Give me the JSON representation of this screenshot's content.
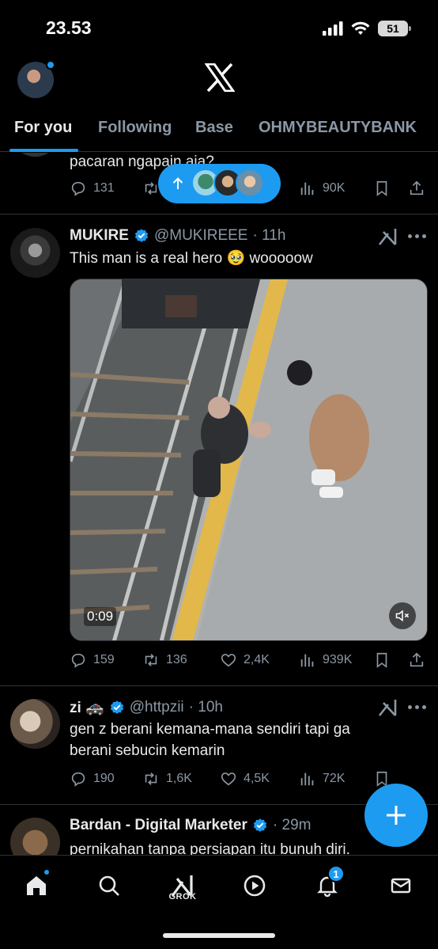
{
  "status_bar": {
    "time": "23.53",
    "battery": "51"
  },
  "tabs": [
    {
      "label": "For you"
    },
    {
      "label": "Following"
    },
    {
      "label": "Base"
    },
    {
      "label": "OHMYBEAUTYBANK"
    }
  ],
  "post0": {
    "text": "pacaran ngapain aja?",
    "replies": "131",
    "views": "90K"
  },
  "post1": {
    "name": "MUKIRE",
    "handle": "@MUKIREEE",
    "time": "· 11h",
    "text": "This man is a real hero 🥹 wooooow",
    "video_time": "0:09",
    "replies": "159",
    "reposts": "136",
    "likes": "2,4K",
    "views": "939K"
  },
  "post2": {
    "name": "zi 🚓",
    "handle": "@httpzii",
    "time": "· 10h",
    "text_line1": "gen z berani kemana-mana sendiri tapi ga",
    "text_line2": "berani sebucin kemarin",
    "replies": "190",
    "reposts": "1,6K",
    "likes": "4,5K",
    "views": "72K"
  },
  "post3": {
    "name": "Bardan - Digital Marketer",
    "time": "· 29m",
    "text": "pernikahan tanpa persiapan itu bunuh diri."
  },
  "bottom_nav": {
    "grok_label": "GROK",
    "notifications_badge": "1"
  },
  "colors": {
    "accent": "#1d9bf0",
    "muted": "#8b98a5",
    "text": "#e7e9ea",
    "divider": "#2f3336"
  }
}
